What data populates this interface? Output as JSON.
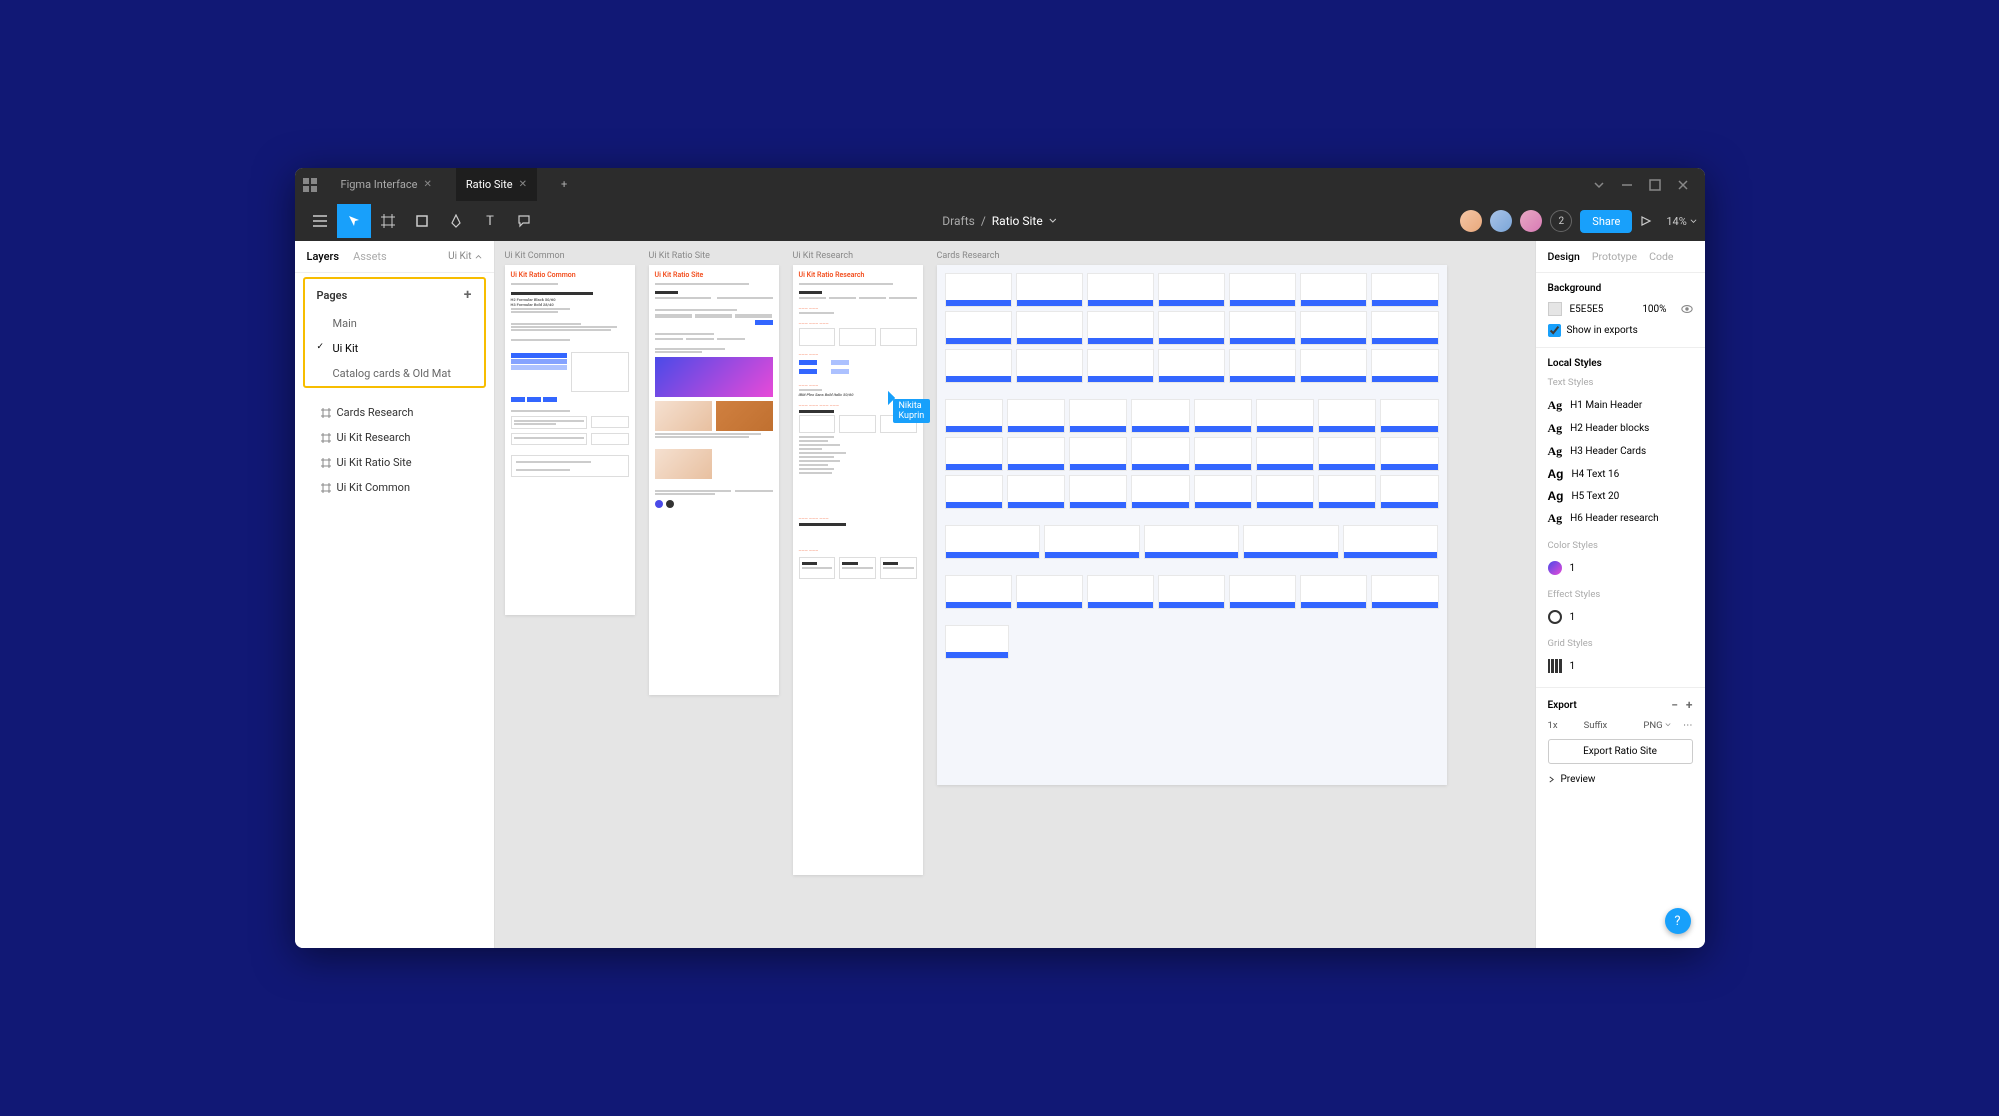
{
  "window": {
    "tabs": [
      {
        "label": "Figma Interface"
      },
      {
        "label": "Ratio Site"
      }
    ]
  },
  "toolbar": {
    "breadcrumb_parent": "Drafts",
    "breadcrumb_sep": "/",
    "breadcrumb_current": "Ratio Site",
    "extra_users": "2",
    "share_label": "Share",
    "zoom": "14%"
  },
  "left_panel": {
    "tabs": {
      "layers": "Layers",
      "assets": "Assets"
    },
    "selector": "Ui Kit",
    "pages_label": "Pages",
    "pages": [
      {
        "name": "Main",
        "checked": false
      },
      {
        "name": "Ui Kit",
        "checked": true
      },
      {
        "name": "Catalog cards & Old Mat",
        "checked": false
      }
    ],
    "layers": [
      "Cards Research",
      "Ui Kit Research",
      "Ui Kit Ratio Site",
      "Ui Kit Common"
    ]
  },
  "canvas": {
    "frames": [
      {
        "label": "Ui Kit Common",
        "title": "Ui Kit Ratio Common"
      },
      {
        "label": "Ui Kit Ratio Site",
        "title": "Ui Kit Ratio Site"
      },
      {
        "label": "Ui Kit Research",
        "title": "Ui Kit Ratio Research"
      },
      {
        "label": "Cards Research",
        "title": ""
      }
    ],
    "cursor_user": "Nikita Kuprin",
    "typography": {
      "h2": "H2 Formular Black 50/60",
      "h3": "H3 Formular Bold 28/40",
      "h4_line": "IBM Plex Sans Bold Italic 50/60"
    }
  },
  "right_panel": {
    "tabs": {
      "design": "Design",
      "prototype": "Prototype",
      "code": "Code"
    },
    "background_label": "Background",
    "bg_color": "E5E5E5",
    "bg_opacity": "100%",
    "show_exports": "Show in exports",
    "local_styles_label": "Local Styles",
    "text_styles_label": "Text Styles",
    "text_styles": [
      "H1 Main Header",
      "H2 Header blocks",
      "H3 Header Cards",
      "H4 Text 16",
      "H5 Text 20",
      "H6 Header research"
    ],
    "color_styles_label": "Color Styles",
    "color_style_count": "1",
    "effect_styles_label": "Effect Styles",
    "effect_style_count": "1",
    "grid_styles_label": "Grid Styles",
    "grid_style_count": "1",
    "export_label": "Export",
    "export_scale": "1x",
    "export_suffix": "Suffix",
    "export_format": "PNG",
    "export_button": "Export Ratio Site",
    "preview_label": "Preview"
  },
  "help": "?"
}
